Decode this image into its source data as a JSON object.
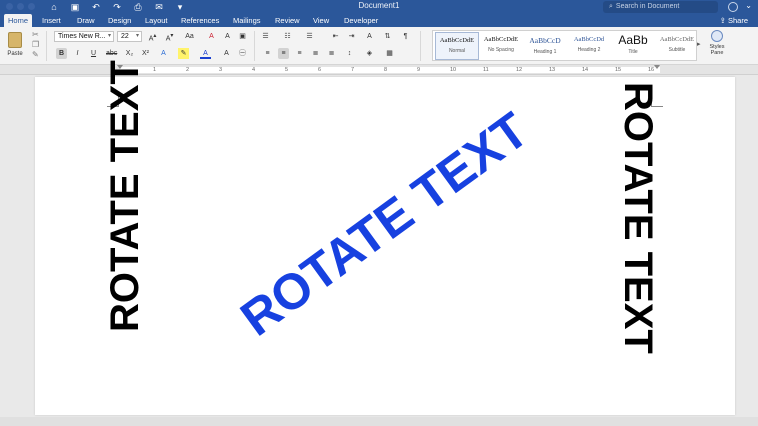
{
  "window": {
    "title": "Document1"
  },
  "search": {
    "placeholder": "Search in Document"
  },
  "tabs": [
    "Home",
    "Insert",
    "Draw",
    "Design",
    "Layout",
    "References",
    "Mailings",
    "Review",
    "View",
    "Developer"
  ],
  "share_label": "Share",
  "ribbon": {
    "paste_label": "Paste",
    "font_name": "Times New R...",
    "font_size": "22",
    "styles": [
      {
        "sample": "AaBbCcDdE",
        "name": "Normal"
      },
      {
        "sample": "AaBbCcDdE",
        "name": "No Spacing"
      },
      {
        "sample": "AaBbCcD",
        "name": "Heading 1"
      },
      {
        "sample": "AaBbCcDd",
        "name": "Heading 2"
      },
      {
        "sample": "AaBb",
        "name": "Title"
      },
      {
        "sample": "AaBbCcDdE",
        "name": "Subtitle"
      }
    ],
    "styles_pane_label_1": "Styles",
    "styles_pane_label_2": "Pane"
  },
  "ruler": {
    "numbers": [
      "1",
      "2",
      "3",
      "4",
      "5",
      "6",
      "7",
      "8",
      "9",
      "10",
      "11",
      "12",
      "13",
      "14",
      "15",
      "16"
    ]
  },
  "document": {
    "text_left": "ROTATE TEXT",
    "text_center": "ROTATE TEXT",
    "text_right": "ROTATE TEXT",
    "center_color": "#1741e0"
  }
}
